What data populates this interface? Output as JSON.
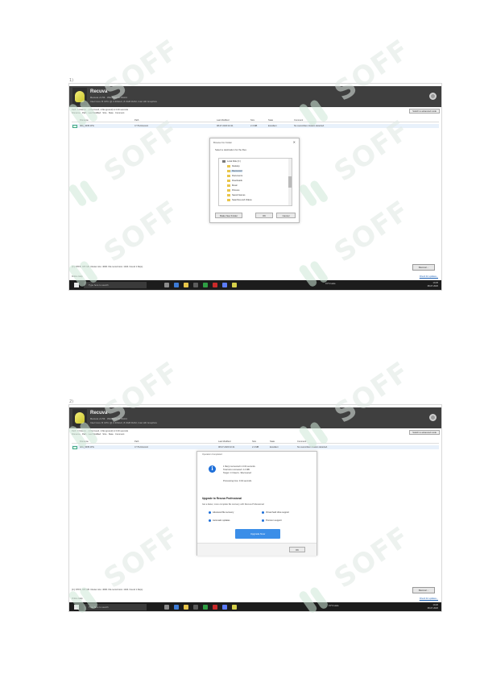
{
  "watermark": {
    "text": "SOFF"
  },
  "screenshots": [
    {
      "marker": "1)",
      "app": {
        "title": "Recuva",
        "subtitle": "Recuva v1.53 · Windows 10 64-bit",
        "subtitle2": "Intel Core i5 CPU @ 2.40GHz, 8.0GB RAM, Intel HD Graphics",
        "info_line1": "Path: C:\\Users\\... (1 file found, 1 file ignored) in 0.00 seconds",
        "info_line2": "Filename · Path · Last Modified · Size · State · Comment",
        "advanced_button": "Switch to advanced mode"
      },
      "table": {
        "headers": [
          "Filename",
          "Path",
          "Last Modified",
          "Size",
          "State",
          "Comment"
        ],
        "row": [
          "IMG_0035.JPG",
          "C:\\?\\Unknown\\",
          "08-07-2020 10:21",
          "2.4 MB",
          "Excellent",
          "No overwritten clusters detected."
        ]
      },
      "dialog": {
        "title": "Browse For Folder",
        "close": "✕",
        "prompt": "Select a destination for the files",
        "tree": [
          {
            "label": "Local Disk (C:)",
            "type": "drive"
          },
          {
            "label": "Desktop",
            "type": "folder"
          },
          {
            "label": "Recovered",
            "type": "folder"
          },
          {
            "label": "Documents",
            "type": "folder"
          },
          {
            "label": "Downloads",
            "type": "folder"
          },
          {
            "label": "Music",
            "type": "folder"
          },
          {
            "label": "Pictures",
            "type": "folder"
          },
          {
            "label": "Saved Games",
            "type": "folder"
          },
          {
            "label": "Searches and Videos",
            "type": "folder"
          }
        ],
        "make_folder_button": "Make New Folder",
        "ok_button": "OK",
        "cancel_button": "Cancel"
      },
      "footer": {
        "line": "[C:] NTFS, 465 GB. Cluster size: 4096. File record size: 1024. Found 1 file(s).",
        "recover_button": "Recover...",
        "status_left": "Online Help",
        "status_right": "Check for updates..."
      },
      "taskbar": {
        "search_placeholder": "Type here to search",
        "weather": "31°C Haze",
        "time": "10:25",
        "date": "08-07-2020"
      }
    },
    {
      "marker": "2)",
      "app": {
        "title": "Recuva",
        "subtitle": "Recuva v1.53 · Windows 10 64-bit",
        "subtitle2": "Intel Core i5 CPU @ 2.40GHz, 8.0GB RAM, Intel HD Graphics",
        "info_line1": "Path: C:\\Users\\... (1 file found, 1 file ignored) in 0.00 seconds",
        "info_line2": "Filename · Path · Last Modified · Size · State · Comment",
        "advanced_button": "Switch to advanced mode"
      },
      "table": {
        "headers": [
          "Filename",
          "Path",
          "Last Modified",
          "Size",
          "State",
          "Comment"
        ],
        "row": [
          "IMG_0035.JPG",
          "C:\\?\\Unknown\\",
          "08-07-2020 10:21",
          "2.4 MB",
          "Excellent",
          "No overwritten clusters detected."
        ]
      },
      "dialog": {
        "title": "Operation Completed",
        "stats": [
          "1 file(s) recovered in 0.04 seconds.",
          "Total size recovered: 2.4 MB",
          "Target: C:\\Users\\...\\Recovered",
          "Processing time: 0.04 seconds"
        ],
        "heading": "Upgrade to Recuva Professional",
        "subtext": "Get a faster, more complete file recovery with Recuva Professional:",
        "options": [
          "Advanced file recovery",
          "Virtual hard drive support",
          "Automatic updates",
          "Premium support"
        ],
        "upgrade_button": "Upgrade Now",
        "ok_button": "OK"
      },
      "footer": {
        "line": "[C:] NTFS, 465 GB. Cluster size: 4096. File record size: 1024. Found 1 file(s).",
        "recover_button": "Recover...",
        "status_left": "Online Help",
        "status_right": "Check for updates..."
      },
      "taskbar": {
        "search_placeholder": "Type here to search",
        "weather": "31°C Haze",
        "time": "10:26",
        "date": "08-07-2020"
      }
    }
  ],
  "colors": {
    "header_bg": "#3f3f3f",
    "taskbar_bg": "#1c1c1c",
    "accent_blue": "#3b8ee8",
    "selection_row": "#e8f1fb"
  },
  "icons": {
    "logo": "recuva-logo-icon",
    "settings": "settings-icon",
    "info": "info-icon",
    "folder": "folder-icon",
    "drive": "drive-icon",
    "windows": "windows-start-icon"
  }
}
